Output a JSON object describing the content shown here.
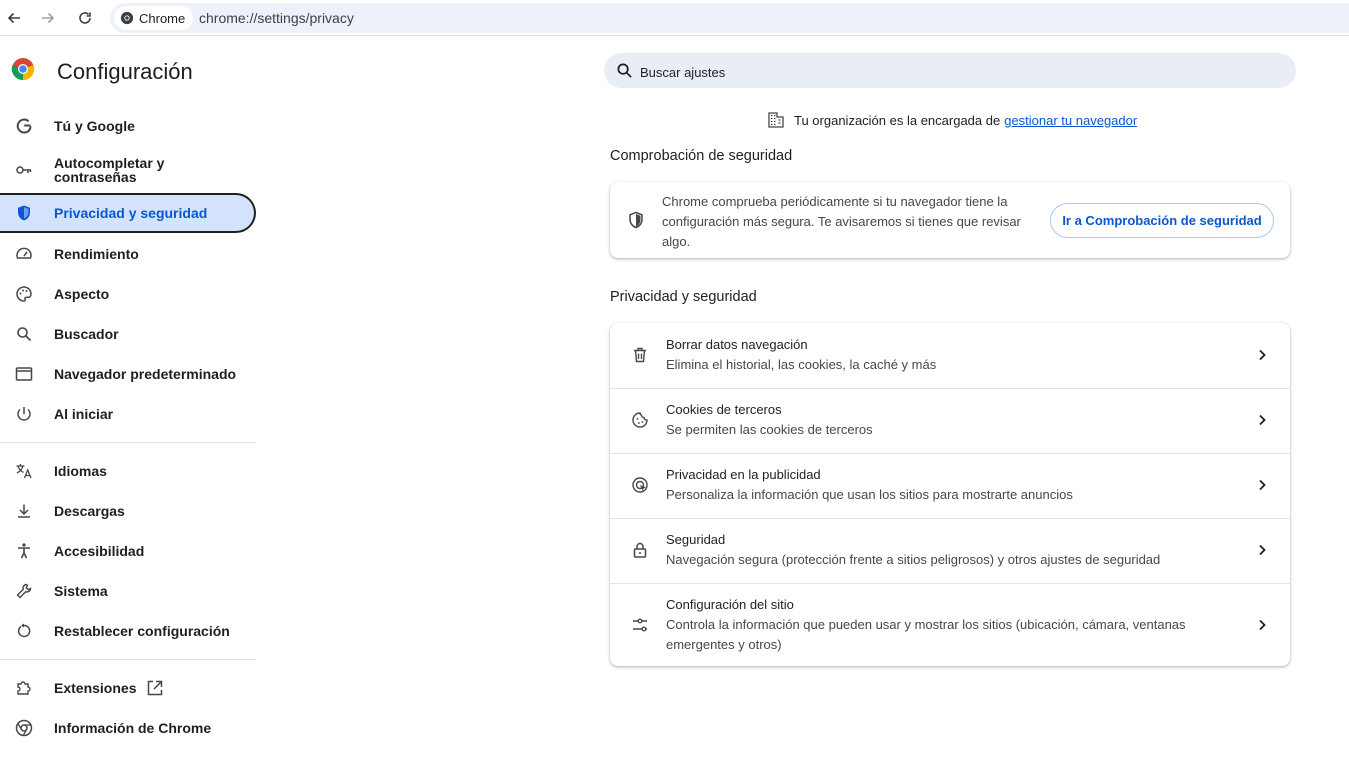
{
  "browser": {
    "chip_label": "Chrome",
    "url": "chrome://settings/privacy"
  },
  "sidebar": {
    "title": "Configuración",
    "items": [
      {
        "label": "Tú y Google",
        "icon": "google-g-icon"
      },
      {
        "label": "Autocompletar y contraseñas",
        "icon": "key-icon"
      },
      {
        "label": "Privacidad y seguridad",
        "icon": "shield-icon",
        "active": true
      },
      {
        "label": "Rendimiento",
        "icon": "speedometer-icon"
      },
      {
        "label": "Aspecto",
        "icon": "palette-icon"
      },
      {
        "label": "Buscador",
        "icon": "search-icon"
      },
      {
        "label": "Navegador predeterminado",
        "icon": "browser-window-icon"
      },
      {
        "label": "Al iniciar",
        "icon": "power-icon"
      },
      {
        "label": "Idiomas",
        "icon": "translate-icon"
      },
      {
        "label": "Descargas",
        "icon": "download-icon"
      },
      {
        "label": "Accesibilidad",
        "icon": "accessibility-icon"
      },
      {
        "label": "Sistema",
        "icon": "wrench-icon"
      },
      {
        "label": "Restablecer configuración",
        "icon": "reset-icon"
      },
      {
        "label": "Extensiones",
        "icon": "puzzle-icon"
      },
      {
        "label": "Información de Chrome",
        "icon": "chrome-icon"
      }
    ]
  },
  "search": {
    "placeholder": "Buscar ajustes"
  },
  "managed": {
    "text": "Tu organización es la encargada de",
    "link": "gestionar tu navegador"
  },
  "safety_check": {
    "section_title": "Comprobación de seguridad",
    "description": "Chrome comprueba periódicamente si tu navegador tiene la configuración más segura. Te avisaremos si tienes que revisar algo.",
    "button_label": "Ir a Comprobación de seguridad"
  },
  "privacy": {
    "section_title": "Privacidad y seguridad",
    "rows": [
      {
        "title": "Borrar datos navegación",
        "subtitle": "Elimina el historial, las cookies, la caché y más",
        "icon": "trash-icon"
      },
      {
        "title": "Cookies de terceros",
        "subtitle": "Se permiten las cookies de terceros",
        "icon": "cookie-icon"
      },
      {
        "title": "Privacidad en la publicidad",
        "subtitle": "Personaliza la información que usan los sitios para mostrarte anuncios",
        "icon": "ad-privacy-icon"
      },
      {
        "title": "Seguridad",
        "subtitle": "Navegación segura (protección frente a sitios peligrosos) y otros ajustes de seguridad",
        "icon": "lock-icon"
      },
      {
        "title": "Configuración del sitio",
        "subtitle": "Controla la información que pueden usar y mostrar los sitios (ubicación, cámara, ventanas emergentes y otros)",
        "icon": "tune-icon"
      }
    ]
  }
}
